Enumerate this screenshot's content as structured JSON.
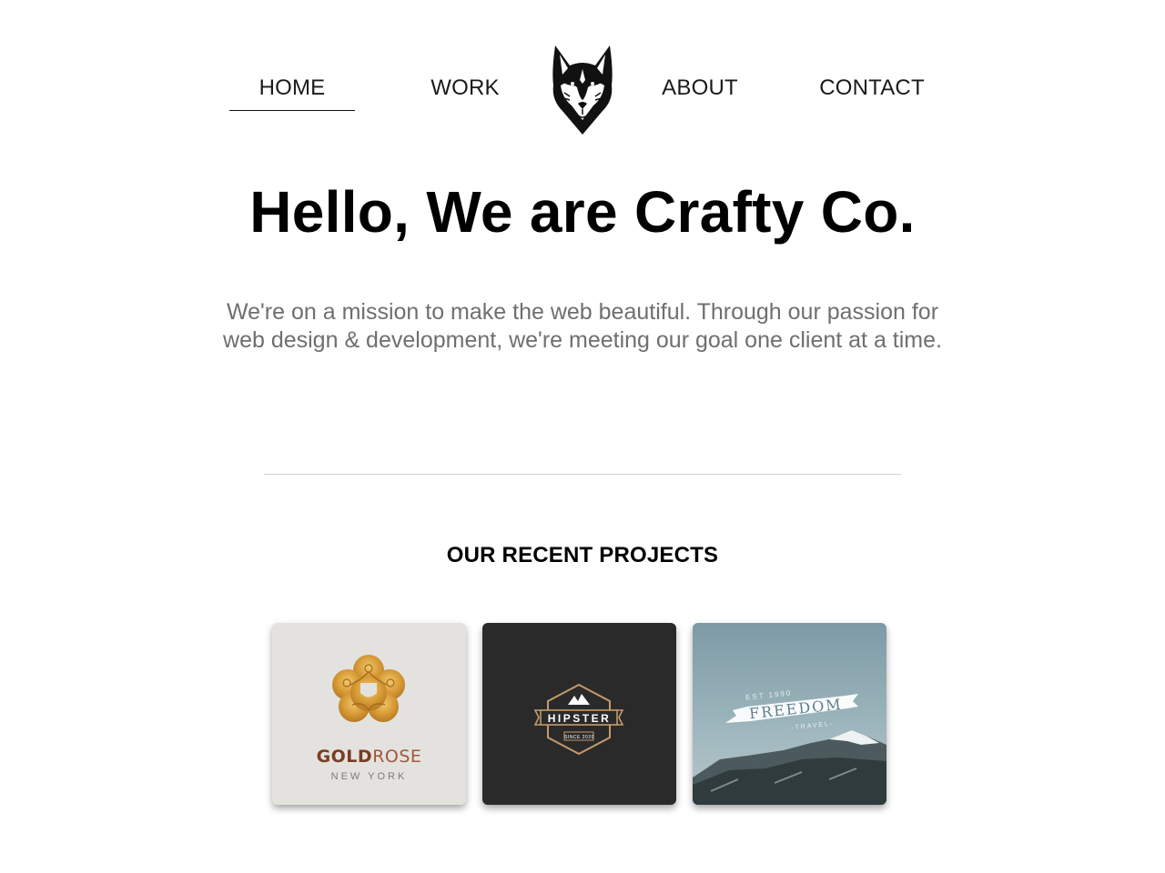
{
  "nav": {
    "items": [
      {
        "label": "HOME",
        "active": true
      },
      {
        "label": "WORK",
        "active": false
      },
      {
        "label": "ABOUT",
        "active": false
      },
      {
        "label": "CONTACT",
        "active": false
      }
    ],
    "logo_icon": "fox-head-icon"
  },
  "hero": {
    "title": "Hello, We are Crafty Co.",
    "text": "We're on a mission to make the web beautiful. Through our passion for web design & development, we're meeting our goal one client at a time."
  },
  "projects": {
    "section_title": "OUR RECENT PROJECTS",
    "items": [
      {
        "brand_part1": "GOLD",
        "brand_part2": "ROSE",
        "subtitle": "NEW YORK"
      },
      {
        "brand": "HIPSTER",
        "subtitle": "SINCE 2020"
      },
      {
        "tagline": "EST 1990",
        "brand": "FREEDOM",
        "subtitle": "-TRAVEL-"
      }
    ]
  },
  "colors": {
    "text_primary": "#000000",
    "text_muted": "#6f6f6f",
    "divider": "#cfcfcf",
    "gold": "#d9a53e",
    "rose": "#7a3d24",
    "card_dark": "#2a2a2a",
    "sky": "#8aa6b0"
  }
}
